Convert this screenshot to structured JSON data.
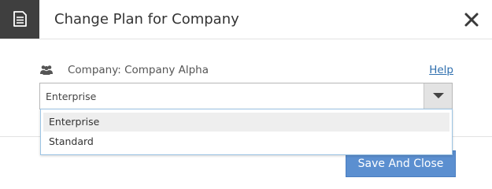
{
  "header": {
    "title": "Change Plan for Company",
    "icon": "document-icon",
    "close_icon": "close-icon"
  },
  "company": {
    "label": "Company: Company Alpha",
    "icon": "users-icon"
  },
  "help": {
    "label": "Help"
  },
  "plan_select": {
    "selected": "Enterprise",
    "options": [
      "Enterprise",
      "Standard"
    ],
    "highlighted_option": "Enterprise"
  },
  "footer": {
    "save_label": "Save And Close"
  },
  "colors": {
    "header_icon_bg": "#3f3f3f",
    "primary_button": "#5b8fd0",
    "link": "#2f6fae",
    "dropdown_border": "#9cc4e4"
  }
}
